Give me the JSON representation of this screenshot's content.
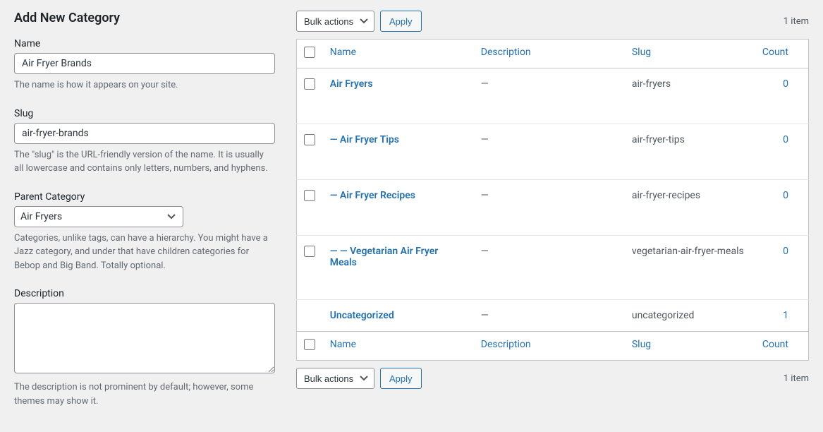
{
  "form": {
    "title": "Add New Category",
    "name_label": "Name",
    "name_value": "Air Fryer Brands",
    "name_help": "The name is how it appears on your site.",
    "slug_label": "Slug",
    "slug_value": "air-fryer-brands",
    "slug_help": "The \"slug\" is the URL-friendly version of the name. It is usually all lowercase and contains only letters, numbers, and hyphens.",
    "parent_label": "Parent Category",
    "parent_selected": "Air Fryers",
    "parent_help": "Categories, unlike tags, can have a hierarchy. You might have a Jazz category, and under that have children categories for Bebop and Big Band. Totally optional.",
    "desc_label": "Description",
    "desc_value": "",
    "desc_help": "The description is not prominent by default; however, some themes may show it."
  },
  "bulk": {
    "select_label": "Bulk actions",
    "apply_label": "Apply"
  },
  "count_text": "1 item",
  "headers": {
    "name": "Name",
    "desc": "Description",
    "slug": "Slug",
    "count": "Count"
  },
  "rows": [
    {
      "name": "Air Fryers",
      "desc": "—",
      "slug": "air-fryers",
      "count": "0"
    },
    {
      "name": "— Air Fryer Tips",
      "desc": "—",
      "slug": "air-fryer-tips",
      "count": "0"
    },
    {
      "name": "— Air Fryer Recipes",
      "desc": "—",
      "slug": "air-fryer-recipes",
      "count": "0"
    },
    {
      "name": "— — Vegetarian Air Fryer Meals",
      "desc": "—",
      "slug": "vegetarian-air-fryer-meals",
      "count": "0"
    },
    {
      "name": "Uncategorized",
      "desc": "—",
      "slug": "uncategorized",
      "count": "1"
    }
  ]
}
